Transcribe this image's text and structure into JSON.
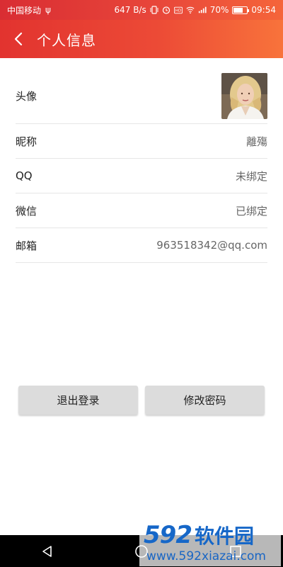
{
  "status_bar": {
    "carrier": "中国移动",
    "usb": "ψ",
    "speed": "647 B/s",
    "battery_text": "70%",
    "battery_level": 0.7,
    "time": "09:54"
  },
  "app_bar": {
    "title": "个人信息"
  },
  "profile": {
    "avatar_label": "头像",
    "nickname_label": "昵称",
    "nickname_value": "離殤",
    "qq_label": "QQ",
    "qq_value": "未绑定",
    "wechat_label": "微信",
    "wechat_value": "已绑定",
    "email_label": "邮箱",
    "email_value": "963518342@qq.com"
  },
  "buttons": {
    "logout": "退出登录",
    "change_password": "修改密码"
  },
  "watermark": {
    "number": "592",
    "name": "软件园",
    "url": "www.592xiazai.com"
  },
  "colors": {
    "header_start": "#e2332f",
    "header_end": "#f8733b",
    "button_bg": "#dcdcdc"
  }
}
